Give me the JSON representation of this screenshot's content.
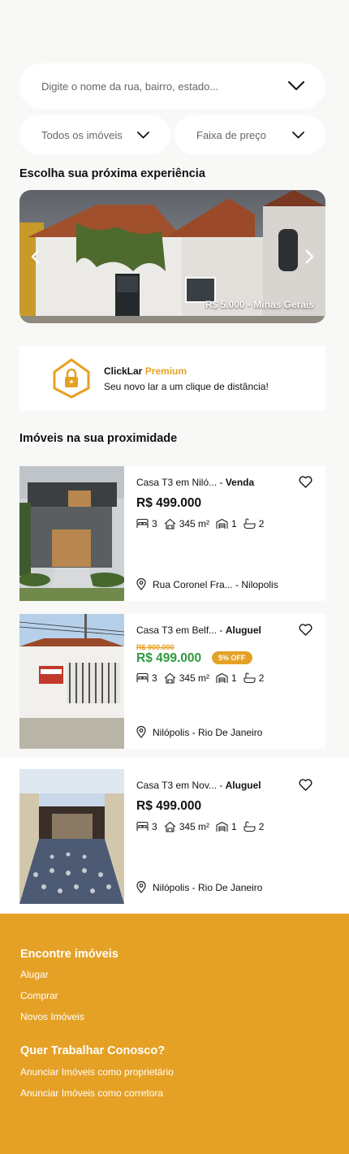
{
  "search": {
    "placeholder": "Digite o nome da rua, bairro, estado..."
  },
  "filters": {
    "type_label": "Todos os imóveis",
    "price_label": "Faixa de preço"
  },
  "featured": {
    "title": "Escolha sua próxima experiência",
    "caption": "R$ 5.000 - Minas Gerais"
  },
  "premium": {
    "brand": "ClickLar",
    "brand_accent": "Premium",
    "tagline": "Seu novo lar a um clique de distância!"
  },
  "nearby": {
    "title": "Imóveis na sua proximidade",
    "listings": [
      {
        "name": "Casa T3 em Niló...",
        "separator": " - ",
        "type": "Venda",
        "old_price": "",
        "price": "R$ 499.000",
        "discount": "",
        "bedrooms": "3",
        "area": "345 m²",
        "garage": "1",
        "bathrooms": "2",
        "location": "Rua Coronel Fra... - Nilopolis"
      },
      {
        "name": "Casa T3 em Belf...",
        "separator": " - ",
        "type": "Aluguel",
        "old_price": "R$ 900.000",
        "price": "R$ 499.000",
        "discount": "5% OFF",
        "bedrooms": "3",
        "area": "345 m²",
        "garage": "1",
        "bathrooms": "2",
        "location": "Nilópolis - Rio De Janeiro"
      },
      {
        "name": "Casa T3 em Nov...",
        "separator": " - ",
        "type": "Aluguel",
        "old_price": "",
        "price": "R$ 499.000",
        "discount": "",
        "bedrooms": "3",
        "area": "345 m²",
        "garage": "1",
        "bathrooms": "2",
        "location": "Nilópolis - Rio De Janeiro"
      }
    ]
  },
  "footer": {
    "find_title": "Encontre imóveis",
    "find_links": [
      "Alugar",
      "Comprar",
      "Novos Imóveis"
    ],
    "work_title": "Quer Trabalhar Conosco?",
    "work_links": [
      "Anunciar Imóveis como proprietário",
      "Anunciar Imóveis como corretora"
    ]
  },
  "colors": {
    "accent": "#e5a125",
    "green_price": "#2c9b3c",
    "background": "#f8f8f6"
  },
  "icons": [
    "chevron-down-icon",
    "chevron-left-icon",
    "chevron-right-icon",
    "house-lock-icon",
    "heart-icon",
    "bed-icon",
    "area-icon",
    "garage-icon",
    "bathtub-icon",
    "location-pin-icon"
  ]
}
